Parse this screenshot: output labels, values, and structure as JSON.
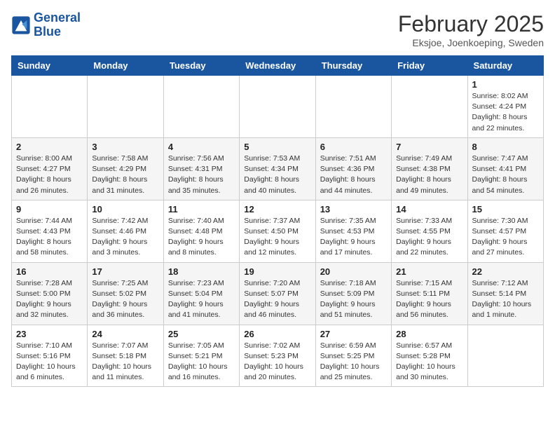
{
  "header": {
    "logo_line1": "General",
    "logo_line2": "Blue",
    "title": "February 2025",
    "subtitle": "Eksjoe, Joenkoeping, Sweden"
  },
  "weekdays": [
    "Sunday",
    "Monday",
    "Tuesday",
    "Wednesday",
    "Thursday",
    "Friday",
    "Saturday"
  ],
  "weeks": [
    [
      {
        "day": "",
        "info": ""
      },
      {
        "day": "",
        "info": ""
      },
      {
        "day": "",
        "info": ""
      },
      {
        "day": "",
        "info": ""
      },
      {
        "day": "",
        "info": ""
      },
      {
        "day": "",
        "info": ""
      },
      {
        "day": "1",
        "info": "Sunrise: 8:02 AM\nSunset: 4:24 PM\nDaylight: 8 hours and 22 minutes."
      }
    ],
    [
      {
        "day": "2",
        "info": "Sunrise: 8:00 AM\nSunset: 4:27 PM\nDaylight: 8 hours and 26 minutes."
      },
      {
        "day": "3",
        "info": "Sunrise: 7:58 AM\nSunset: 4:29 PM\nDaylight: 8 hours and 31 minutes."
      },
      {
        "day": "4",
        "info": "Sunrise: 7:56 AM\nSunset: 4:31 PM\nDaylight: 8 hours and 35 minutes."
      },
      {
        "day": "5",
        "info": "Sunrise: 7:53 AM\nSunset: 4:34 PM\nDaylight: 8 hours and 40 minutes."
      },
      {
        "day": "6",
        "info": "Sunrise: 7:51 AM\nSunset: 4:36 PM\nDaylight: 8 hours and 44 minutes."
      },
      {
        "day": "7",
        "info": "Sunrise: 7:49 AM\nSunset: 4:38 PM\nDaylight: 8 hours and 49 minutes."
      },
      {
        "day": "8",
        "info": "Sunrise: 7:47 AM\nSunset: 4:41 PM\nDaylight: 8 hours and 54 minutes."
      }
    ],
    [
      {
        "day": "9",
        "info": "Sunrise: 7:44 AM\nSunset: 4:43 PM\nDaylight: 8 hours and 58 minutes."
      },
      {
        "day": "10",
        "info": "Sunrise: 7:42 AM\nSunset: 4:46 PM\nDaylight: 9 hours and 3 minutes."
      },
      {
        "day": "11",
        "info": "Sunrise: 7:40 AM\nSunset: 4:48 PM\nDaylight: 9 hours and 8 minutes."
      },
      {
        "day": "12",
        "info": "Sunrise: 7:37 AM\nSunset: 4:50 PM\nDaylight: 9 hours and 12 minutes."
      },
      {
        "day": "13",
        "info": "Sunrise: 7:35 AM\nSunset: 4:53 PM\nDaylight: 9 hours and 17 minutes."
      },
      {
        "day": "14",
        "info": "Sunrise: 7:33 AM\nSunset: 4:55 PM\nDaylight: 9 hours and 22 minutes."
      },
      {
        "day": "15",
        "info": "Sunrise: 7:30 AM\nSunset: 4:57 PM\nDaylight: 9 hours and 27 minutes."
      }
    ],
    [
      {
        "day": "16",
        "info": "Sunrise: 7:28 AM\nSunset: 5:00 PM\nDaylight: 9 hours and 32 minutes."
      },
      {
        "day": "17",
        "info": "Sunrise: 7:25 AM\nSunset: 5:02 PM\nDaylight: 9 hours and 36 minutes."
      },
      {
        "day": "18",
        "info": "Sunrise: 7:23 AM\nSunset: 5:04 PM\nDaylight: 9 hours and 41 minutes."
      },
      {
        "day": "19",
        "info": "Sunrise: 7:20 AM\nSunset: 5:07 PM\nDaylight: 9 hours and 46 minutes."
      },
      {
        "day": "20",
        "info": "Sunrise: 7:18 AM\nSunset: 5:09 PM\nDaylight: 9 hours and 51 minutes."
      },
      {
        "day": "21",
        "info": "Sunrise: 7:15 AM\nSunset: 5:11 PM\nDaylight: 9 hours and 56 minutes."
      },
      {
        "day": "22",
        "info": "Sunrise: 7:12 AM\nSunset: 5:14 PM\nDaylight: 10 hours and 1 minute."
      }
    ],
    [
      {
        "day": "23",
        "info": "Sunrise: 7:10 AM\nSunset: 5:16 PM\nDaylight: 10 hours and 6 minutes."
      },
      {
        "day": "24",
        "info": "Sunrise: 7:07 AM\nSunset: 5:18 PM\nDaylight: 10 hours and 11 minutes."
      },
      {
        "day": "25",
        "info": "Sunrise: 7:05 AM\nSunset: 5:21 PM\nDaylight: 10 hours and 16 minutes."
      },
      {
        "day": "26",
        "info": "Sunrise: 7:02 AM\nSunset: 5:23 PM\nDaylight: 10 hours and 20 minutes."
      },
      {
        "day": "27",
        "info": "Sunrise: 6:59 AM\nSunset: 5:25 PM\nDaylight: 10 hours and 25 minutes."
      },
      {
        "day": "28",
        "info": "Sunrise: 6:57 AM\nSunset: 5:28 PM\nDaylight: 10 hours and 30 minutes."
      },
      {
        "day": "",
        "info": ""
      }
    ]
  ]
}
